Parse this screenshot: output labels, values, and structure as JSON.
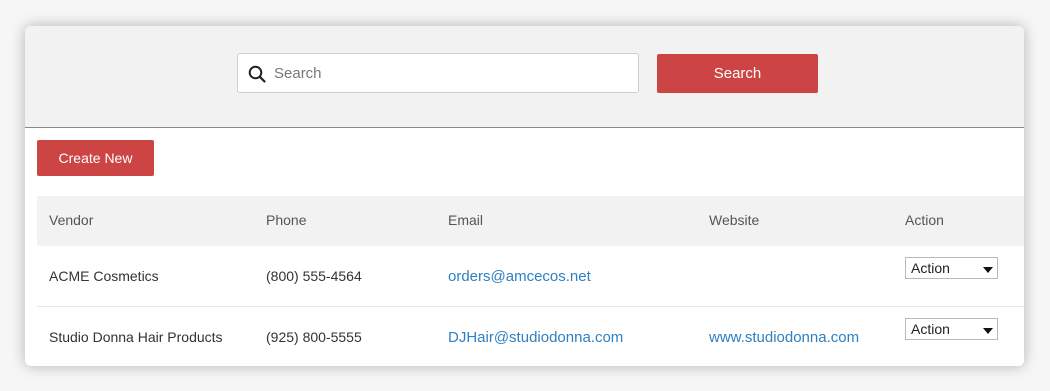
{
  "search": {
    "placeholder": "Search",
    "button_label": "Search"
  },
  "toolbar": {
    "create_label": "Create New"
  },
  "table": {
    "headers": {
      "vendor": "Vendor",
      "phone": "Phone",
      "email": "Email",
      "website": "Website",
      "action": "Action"
    },
    "rows": [
      {
        "vendor": "ACME Cosmetics",
        "phone": "(800) 555-4564",
        "email": "orders@amcecos.net",
        "website": "",
        "action": "Action"
      },
      {
        "vendor": "Studio Donna Hair Products",
        "phone": "(925) 800-5555",
        "email": "DJHair@studiodonna.com",
        "website": "www.studiodonna.com",
        "action": "Action"
      }
    ]
  },
  "colors": {
    "accent": "#cc4544",
    "link": "#2f7fc1",
    "band": "#f2f2f2"
  },
  "icons": {
    "search": "search-icon",
    "dropdown": "caret-down-icon"
  }
}
